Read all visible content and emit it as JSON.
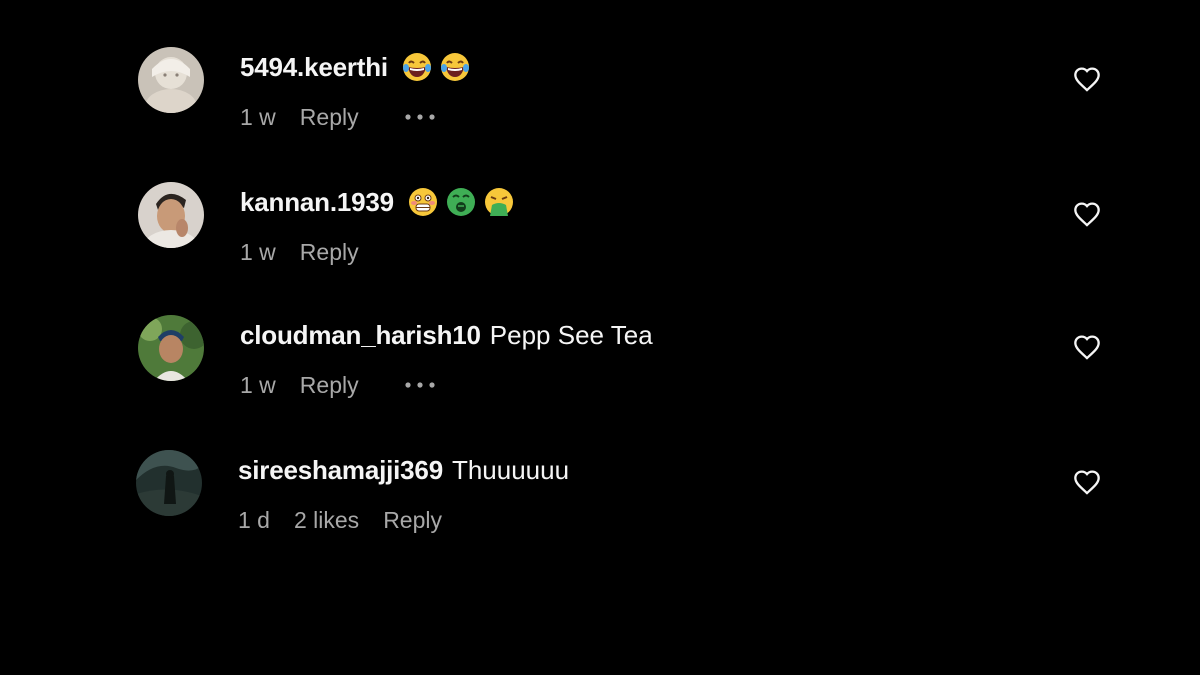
{
  "colors": {
    "background": "#000000",
    "text_primary": "#f5f5f5",
    "text_secondary": "#a8a8a8"
  },
  "comments": [
    {
      "username": "5494.keerthi",
      "text": "",
      "emojis": [
        "laughing-with-tears-emoji",
        "laughing-with-tears-emoji"
      ],
      "time": "1 w",
      "likes": "",
      "reply_label": "Reply",
      "more_icon": "ellipsis-icon",
      "like_icon": "heart-outline-icon"
    },
    {
      "username": "kannan.1939",
      "text": "",
      "emojis": [
        "grimacing-flushed-emoji",
        "nauseated-face-emoji",
        "vomiting-face-emoji"
      ],
      "time": "1 w",
      "likes": "",
      "reply_label": "Reply",
      "like_icon": "heart-outline-icon"
    },
    {
      "username": "cloudman_harish10",
      "text": "Pepp See Tea",
      "time": "1 w",
      "likes": "",
      "reply_label": "Reply",
      "more_icon": "ellipsis-icon",
      "like_icon": "heart-outline-icon"
    },
    {
      "username": "sireeshamajji369",
      "text": "Thuuuuuu",
      "time": "1 d",
      "likes": "2 likes",
      "reply_label": "Reply",
      "like_icon": "heart-outline-icon"
    }
  ]
}
